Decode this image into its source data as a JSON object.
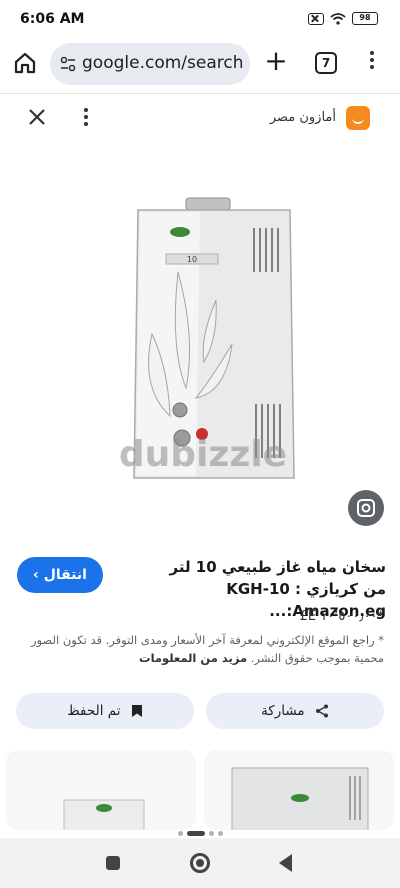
{
  "status_bar": {
    "time": "6:06 AM",
    "battery": "98"
  },
  "browser": {
    "url": "google.com/search",
    "tab_count": "7",
    "icons": [
      "home-icon",
      "tune-icon",
      "plus-icon",
      "tabs-icon",
      "more-vert-icon"
    ]
  },
  "viewer": {
    "source_name": "أمازون مصر",
    "icons": [
      "close-icon",
      "more-vert-icon",
      "amazon-logo-icon"
    ]
  },
  "image": {
    "watermark": "dubizzle",
    "label_on_unit": "10"
  },
  "result": {
    "title": "سخان مياه غاز طبيعي 10 لتر من كريازي KGH-10 : Amazon.eg:...",
    "visit_label": "انتقال",
    "price": "*‏١٠٬٥٠٠٫٠٠ E£",
    "disclaimer_text": "* راجع الموقع الإلكتروني لمعرفة آخر الأسعار ومدى التوفر. قد تكون الصور محمية بموجب حقوق النشر.",
    "disclaimer_link": "مزيد من المعلومات"
  },
  "actions": {
    "share_label": "مشاركة",
    "saved_label": "تم الحفظ"
  },
  "colors": {
    "accent": "#1a73e8",
    "amazon": "#f58a1f",
    "pill_bg": "#e8eaf1",
    "button_bg": "#e9eef8"
  }
}
